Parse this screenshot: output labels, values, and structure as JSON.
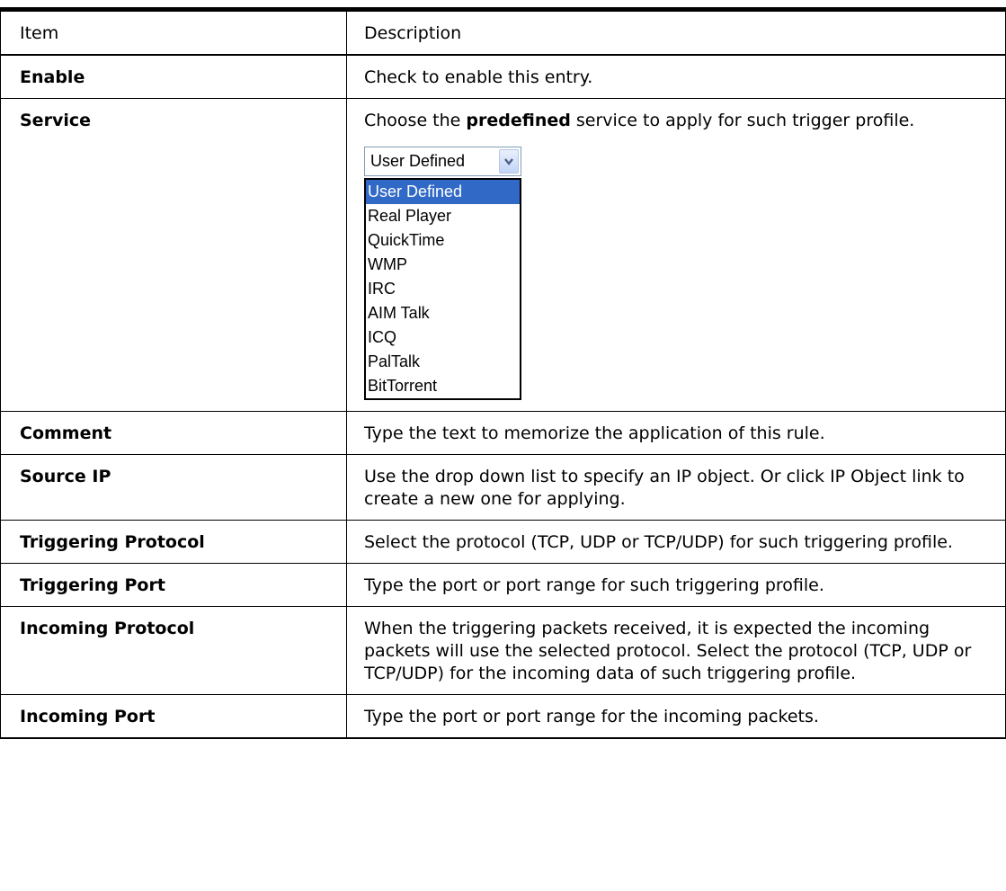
{
  "header": {
    "item": "Item",
    "description": "Description"
  },
  "rows": [
    {
      "item": "Enable",
      "desc": "Check to enable this entry."
    },
    {
      "item": "Service",
      "desc_pre": "Choose the ",
      "desc_bold": "predefined",
      "desc_post": " service to apply for such trigger profile."
    },
    {
      "item": "Comment",
      "desc": "Type the text to memorize the application of this rule."
    },
    {
      "item": "Source IP",
      "desc": "Use the drop down list to specify an IP object. Or click IP Object link to create a new one for applying."
    },
    {
      "item": "Triggering Protocol",
      "desc": "Select the protocol (TCP, UDP or TCP/UDP) for such triggering profile."
    },
    {
      "item": "Triggering Port",
      "desc": "Type the port or port range for such triggering profile."
    },
    {
      "item": "Incoming Protocol",
      "desc": "When the triggering packets received, it is expected the incoming packets will use the selected protocol. Select the protocol (TCP, UDP or TCP/UDP) for the incoming data of such triggering profile."
    },
    {
      "item": "Incoming Port",
      "desc": "Type the port or port range for the incoming packets."
    }
  ],
  "service_dropdown": {
    "selected": "User Defined",
    "icon": "chevron-down-icon",
    "options": [
      "User Defined",
      "Real Player",
      "QuickTime",
      "WMP",
      "IRC",
      "AIM Talk",
      "ICQ",
      "PalTalk",
      "BitTorrent"
    ],
    "highlighted_index": 0,
    "highlight_color": "#3169c6"
  }
}
